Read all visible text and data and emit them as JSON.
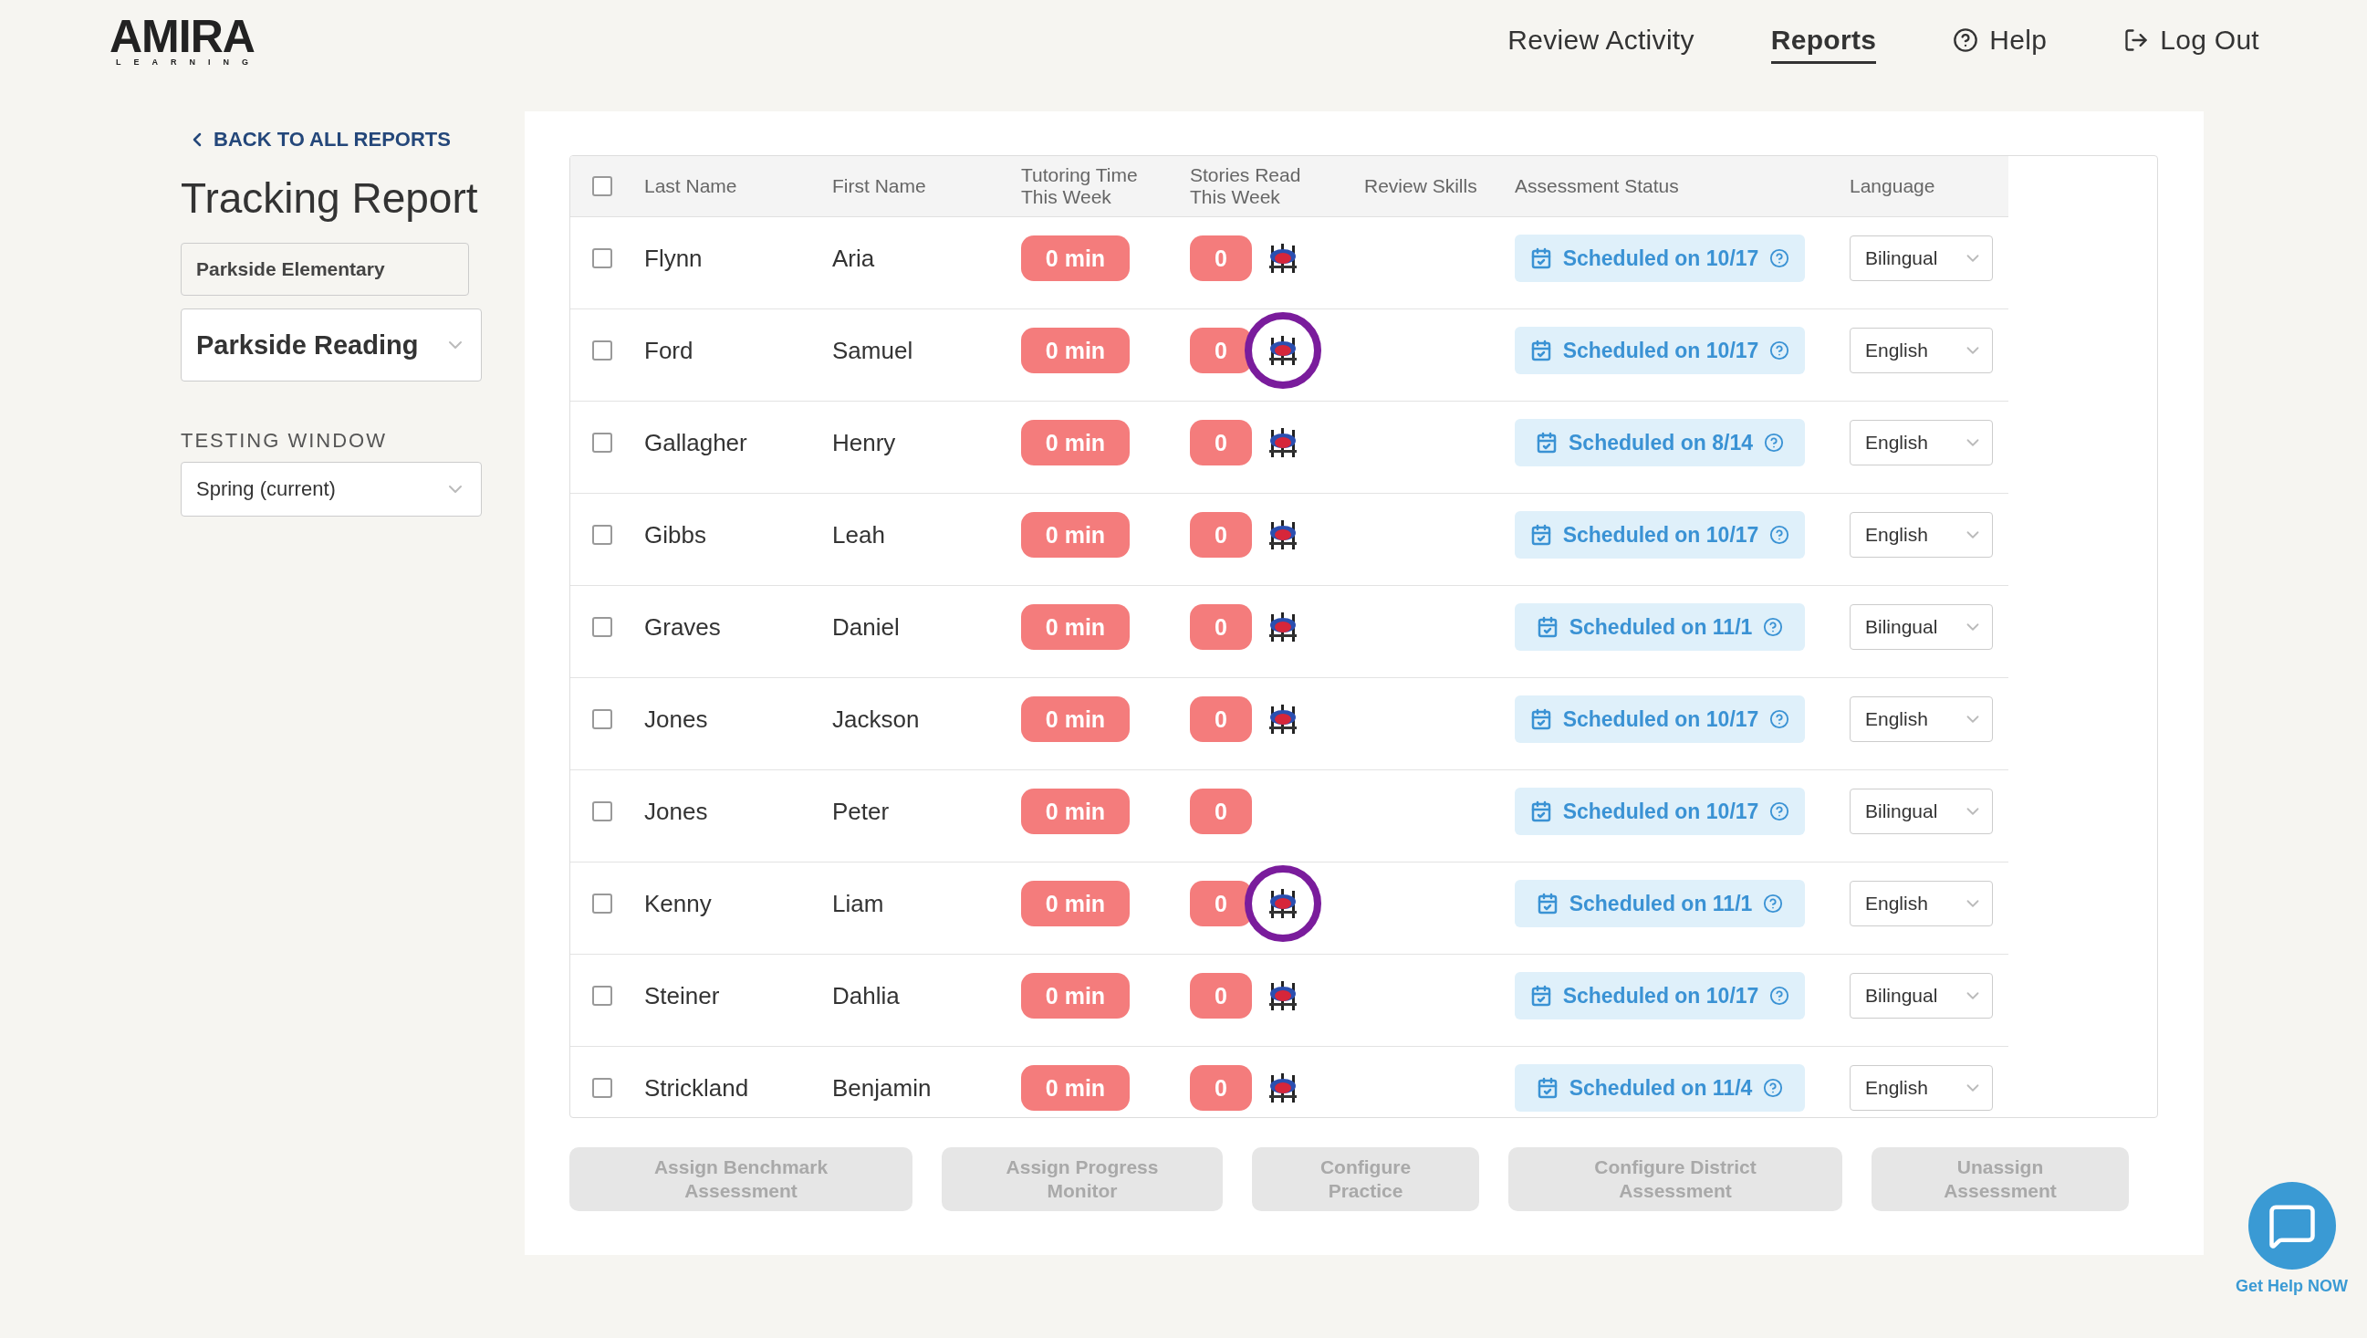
{
  "logo": {
    "name": "AMIRA",
    "tagline": "LEARNING"
  },
  "nav": [
    {
      "label": "Review Activity",
      "kind": "link",
      "selected": false
    },
    {
      "label": "Reports",
      "kind": "link",
      "selected": true
    },
    {
      "label": "Help",
      "kind": "help",
      "selected": false
    },
    {
      "label": "Log Out",
      "kind": "logout",
      "selected": false
    }
  ],
  "sidebar": {
    "back_link": "BACK TO ALL REPORTS",
    "title": "Tracking Report",
    "school": "Parkside Elementary",
    "class_select": "Parkside Reading",
    "testing_window": {
      "label": "TESTING WINDOW",
      "value": "Spring (current)"
    }
  },
  "table": {
    "select_all_checked": false,
    "columns": [
      "Last Name",
      "First Name",
      "Tutoring Time This Week",
      "Stories Read This Week",
      "Review Skills",
      "Assessment Status",
      "Language"
    ],
    "rows": [
      {
        "last": "Flynn",
        "first": "Aria",
        "tutoring": "0 min",
        "stories": "0",
        "has_icon": true,
        "highlighted": false,
        "status": "Scheduled on 10/17",
        "language": "Bilingual",
        "checked": false
      },
      {
        "last": "Ford",
        "first": "Samuel",
        "tutoring": "0 min",
        "stories": "0",
        "has_icon": true,
        "highlighted": true,
        "status": "Scheduled on 10/17",
        "language": "English",
        "checked": false
      },
      {
        "last": "Gallagher",
        "first": "Henry",
        "tutoring": "0 min",
        "stories": "0",
        "has_icon": true,
        "highlighted": false,
        "status": "Scheduled on 8/14",
        "language": "English",
        "checked": false
      },
      {
        "last": "Gibbs",
        "first": "Leah",
        "tutoring": "0 min",
        "stories": "0",
        "has_icon": true,
        "highlighted": false,
        "status": "Scheduled on 10/17",
        "language": "English",
        "checked": false
      },
      {
        "last": "Graves",
        "first": "Daniel",
        "tutoring": "0 min",
        "stories": "0",
        "has_icon": true,
        "highlighted": false,
        "status": "Scheduled on 11/1",
        "language": "Bilingual",
        "checked": false
      },
      {
        "last": "Jones",
        "first": "Jackson",
        "tutoring": "0 min",
        "stories": "0",
        "has_icon": true,
        "highlighted": false,
        "status": "Scheduled on 10/17",
        "language": "English",
        "checked": false
      },
      {
        "last": "Jones",
        "first": "Peter",
        "tutoring": "0 min",
        "stories": "0",
        "has_icon": false,
        "highlighted": false,
        "status": "Scheduled on 10/17",
        "language": "Bilingual",
        "checked": false
      },
      {
        "last": "Kenny",
        "first": "Liam",
        "tutoring": "0 min",
        "stories": "0",
        "has_icon": true,
        "highlighted": true,
        "status": "Scheduled on 11/1",
        "language": "English",
        "checked": false
      },
      {
        "last": "Steiner",
        "first": "Dahlia",
        "tutoring": "0 min",
        "stories": "0",
        "has_icon": true,
        "highlighted": false,
        "status": "Scheduled on 10/17",
        "language": "Bilingual",
        "checked": false
      },
      {
        "last": "Strickland",
        "first": "Benjamin",
        "tutoring": "0 min",
        "stories": "0",
        "has_icon": true,
        "highlighted": false,
        "status": "Scheduled on 11/4",
        "language": "English",
        "checked": false
      }
    ]
  },
  "actions": [
    {
      "label": "Assign Benchmark Assessment",
      "disabled": true
    },
    {
      "label": "Assign Progress Monitor",
      "disabled": true
    },
    {
      "label": "Configure Practice",
      "disabled": true
    },
    {
      "label": "Configure District Assessment",
      "disabled": true
    },
    {
      "label": "Unassign Assessment",
      "disabled": true
    }
  ],
  "help_widget": {
    "label": "Get Help NOW"
  }
}
